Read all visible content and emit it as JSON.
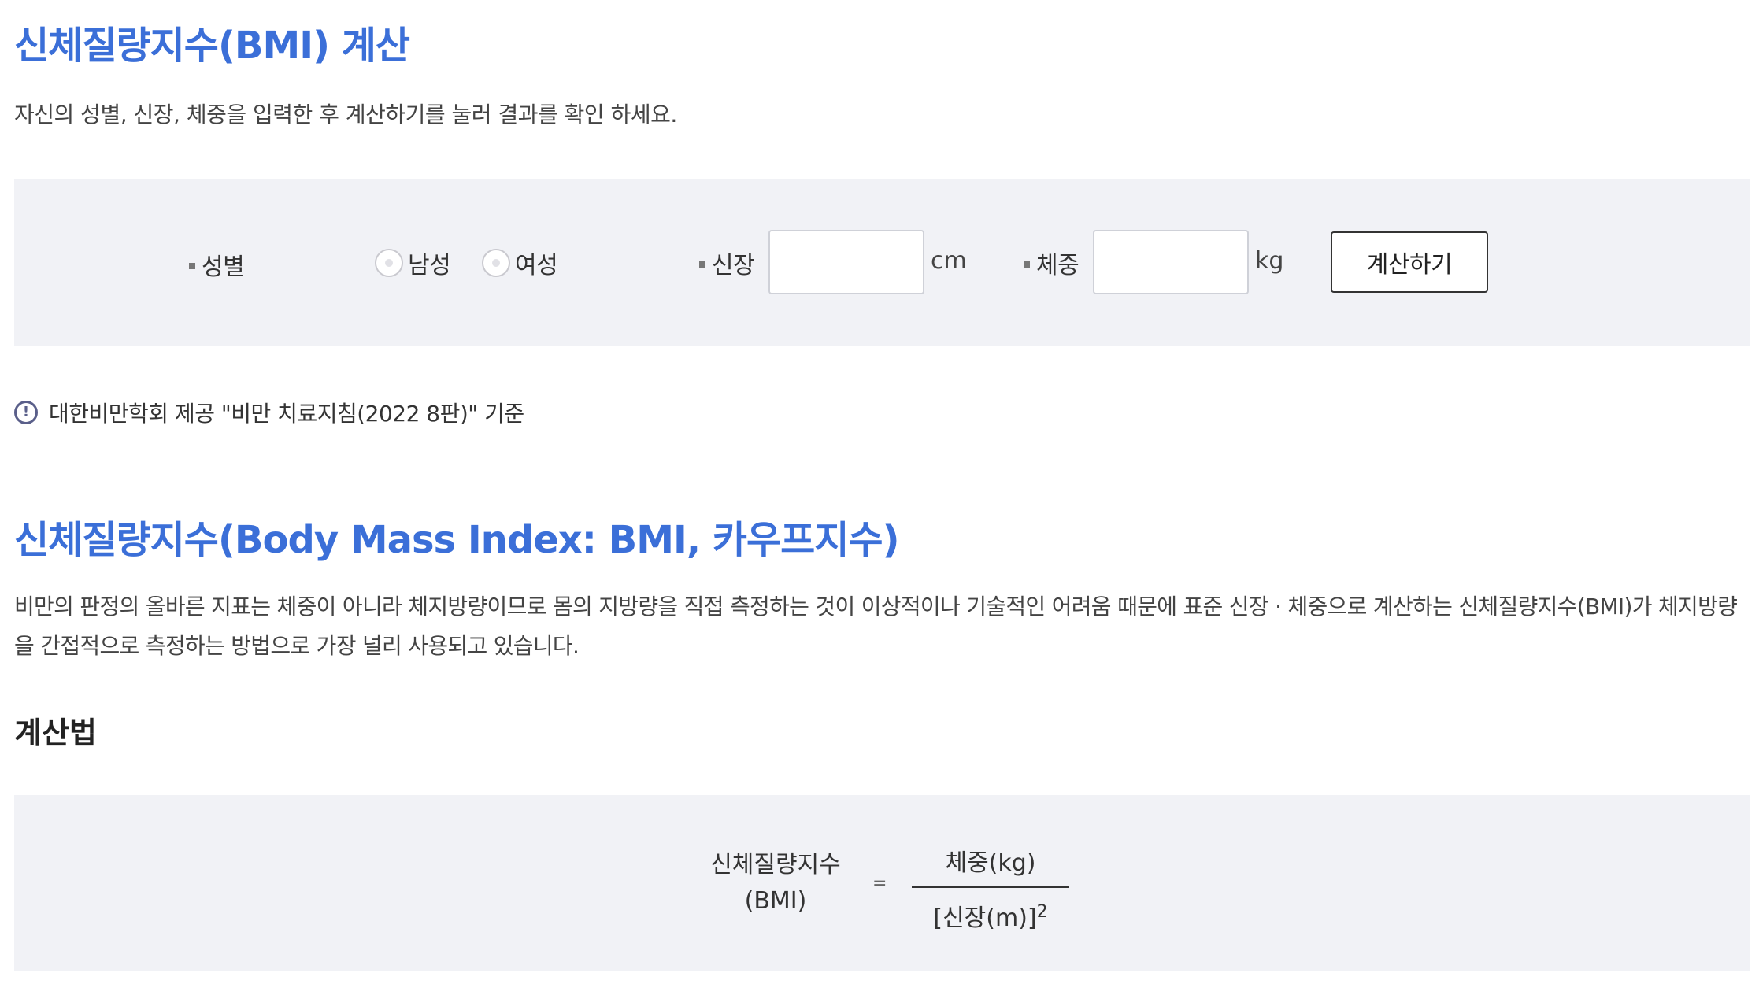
{
  "header": {
    "title": "신체질량지수(BMI) 계산",
    "description": "자신의 성별, 신장, 체중을 입력한 후 계산하기를 눌러 결과를 확인 하세요."
  },
  "calculator": {
    "gender_label": "성별",
    "gender_options": [
      "남성",
      "여성"
    ],
    "height_label": "신장",
    "height_value": "",
    "height_unit": "cm",
    "weight_label": "체중",
    "weight_value": "",
    "weight_unit": "kg",
    "calculate_label": "계산하기"
  },
  "notice": {
    "icon": "exclamation-circle-icon",
    "text": "대한비만학회 제공 \"비만 치료지침(2022 8판)\" 기준"
  },
  "info": {
    "title": "신체질량지수(Body Mass Index: BMI, 카우프지수)",
    "paragraph": "비만의 판정의 올바른 지표는 체중이 아니라 체지방량이므로 몸의 지방량을 직접 측정하는 것이 이상적이나 기술적인 어려움 때문에 표준 신장 · 체중으로 계산하는 신체질량지수(BMI)가 체지방량을 간접적으로 측정하는 방법으로 가장 널리 사용되고 있습니다.",
    "method_title": "계산법"
  },
  "formula": {
    "left_line1": "신체질량지수",
    "left_line2": "(BMI)",
    "equals": "=",
    "numerator": "체중(kg)",
    "denominator": "[신장(m)]",
    "exponent": "2"
  },
  "colors": {
    "accent": "#3b6fd8",
    "panel_bg": "#f1f2f6"
  }
}
